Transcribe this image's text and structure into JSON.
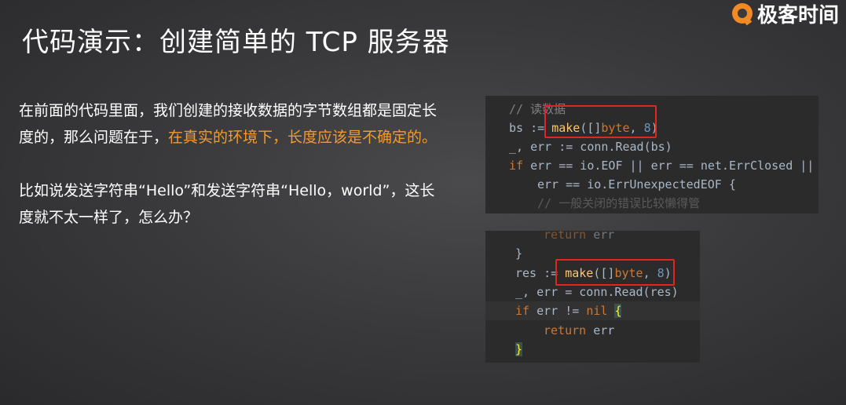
{
  "slide": {
    "title": "代码演示：创建简单的 TCP 服务器"
  },
  "logo": {
    "icon": "geekbang-logo-icon",
    "text": "极客时间"
  },
  "body": {
    "para1_normal": "在前面的代码里面，我们创建的接收数据的字节数组都是固定长度的，那么问题在于，",
    "para1_highlight": "在真实的环境下，长度应该是不确定的。",
    "para2": "比如说发送字符串“Hello”和发送字符串“Hello，world”，这长度就不太一样了，怎么办？"
  },
  "code_top": {
    "line1": "// 读数据",
    "line2_a": "bs := ",
    "line2_fn": "make",
    "line2_b": "([]",
    "line2_kw": "byte",
    "line2_c": ", ",
    "line2_num": "8",
    "line2_d": ")",
    "line3": "_, err := conn.Read(bs)",
    "line4_kw": "if",
    "line4_rest": " err == io.EOF || err == net.ErrClosed ||",
    "line5": "err == io.ErrUnexpectedEOF {",
    "line6": "// 一般关闭的错误比较懒得管"
  },
  "code_bottom": {
    "line1_kw": "return",
    "line1_rest": " err",
    "line2": "}",
    "line3_a": "res := ",
    "line3_fn": "make",
    "line3_b": "([]",
    "line3_kw": "byte",
    "line3_c": ", ",
    "line3_num": "8",
    "line3_d": ")",
    "line4": "_, err = conn.Read(res)",
    "line5_kw": "if",
    "line5_a": " err != ",
    "line5_nil": "nil",
    "line5_sp": " ",
    "line5_brace": "{",
    "line6_kw": "return",
    "line6_rest": " err",
    "line7": "}"
  },
  "colors": {
    "highlight": "#f39a2e",
    "keyword": "#cc7832",
    "function": "#ffc66d",
    "number": "#6897bb",
    "comment": "#808080",
    "box": "#e0261f"
  }
}
